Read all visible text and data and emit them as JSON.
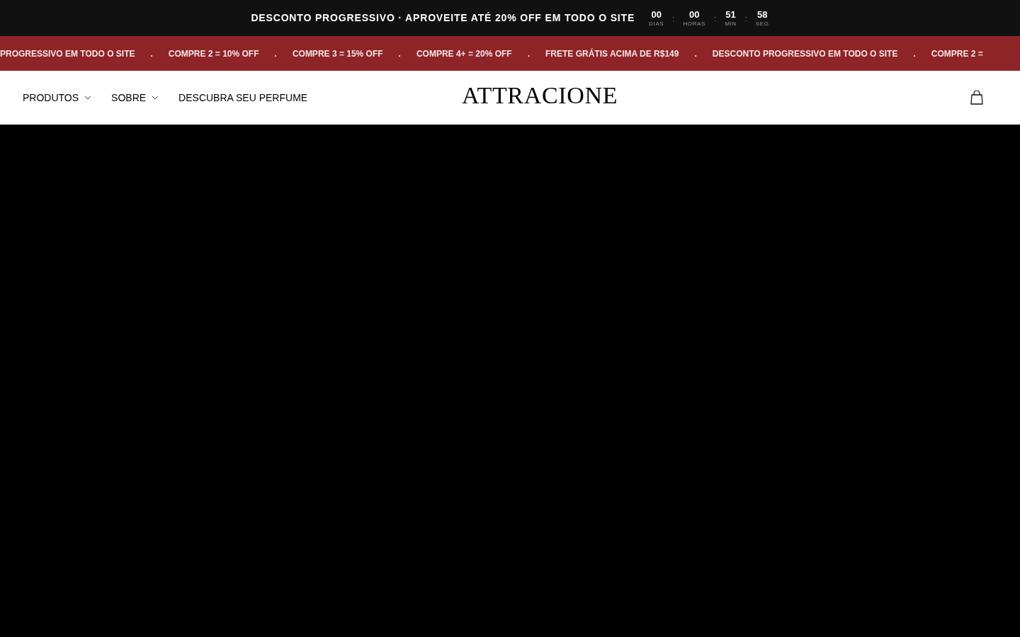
{
  "promo_bar": {
    "headline": "DESCONTO PROGRESSIVO · APROVEITE ATÉ **20% OFF** EM TODO O SITE",
    "countdown": [
      {
        "value": "00",
        "unit": "DIAS"
      },
      {
        "value": "00",
        "unit": "HORAS"
      },
      {
        "value": "51",
        "unit": "MIN"
      },
      {
        "value": "58",
        "unit": "SEG"
      }
    ],
    "separator": ":"
  },
  "ticker": [
    "PROGRESSIVO EM TODO O SITE",
    ".",
    "COMPRE 2 = 10% OFF",
    ".",
    "COMPRE 3 = 15% OFF",
    ".",
    "COMPRE 4+ = 20% OFF",
    ".",
    "FRETE GRÁTIS ACIMA DE R$149",
    ".",
    "DESCONTO PROGRESSIVO EM TODO O SITE",
    ".",
    "COMPRE 2 ="
  ],
  "nav": [
    {
      "label": "PRODUTOS",
      "dropdown": true
    },
    {
      "label": "SOBRE",
      "dropdown": true
    },
    {
      "label": "DESCUBRA SEU PERFUME",
      "dropdown": false
    }
  ],
  "logo": "ATTRACIONE"
}
